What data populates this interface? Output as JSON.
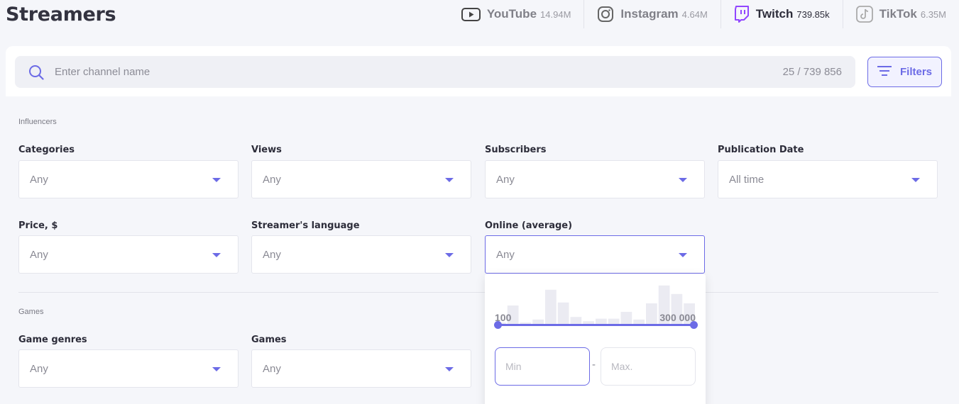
{
  "page": {
    "title": "Streamers"
  },
  "platforms": [
    {
      "name": "YouTube",
      "count": "14.94M",
      "icon": "youtube-icon",
      "active": false
    },
    {
      "name": "Instagram",
      "count": "4.64M",
      "icon": "instagram-icon",
      "active": false
    },
    {
      "name": "Twitch",
      "count": "739.85k",
      "icon": "twitch-icon",
      "active": true
    },
    {
      "name": "TikTok",
      "count": "6.35M",
      "icon": "tiktok-icon",
      "active": false
    }
  ],
  "search": {
    "placeholder": "Enter channel name",
    "count": "25 / 739 856"
  },
  "filters_button": {
    "label": "Filters"
  },
  "sections": {
    "influencers": "Influencers",
    "games": "Games"
  },
  "fields": {
    "categories": {
      "label": "Categories",
      "value": "Any"
    },
    "views": {
      "label": "Views",
      "value": "Any"
    },
    "subscribers": {
      "label": "Subscribers",
      "value": "Any"
    },
    "publication_date": {
      "label": "Publication Date",
      "value": "All time"
    },
    "price": {
      "label": "Price, $",
      "value": "Any"
    },
    "language": {
      "label": "Streamer's language",
      "value": "Any"
    },
    "online": {
      "label": "Online (average)",
      "value": "Any"
    },
    "game_genres": {
      "label": "Game genres",
      "value": "Any"
    },
    "games": {
      "label": "Games",
      "value": "Any"
    }
  },
  "online_popover": {
    "range_min": "100",
    "range_max": "300 000",
    "min_placeholder": "Min",
    "max_placeholder": "Max.",
    "separator": "-",
    "histogram": [
      0.05,
      0.45,
      0.05,
      0.12,
      0.82,
      0.52,
      0.18,
      0.08,
      0.14,
      0.14,
      0.3,
      0.12,
      0.5,
      0.92,
      0.72,
      0.5
    ]
  },
  "colors": {
    "accent": "#6c6be6",
    "twitch": "#9146ff"
  }
}
